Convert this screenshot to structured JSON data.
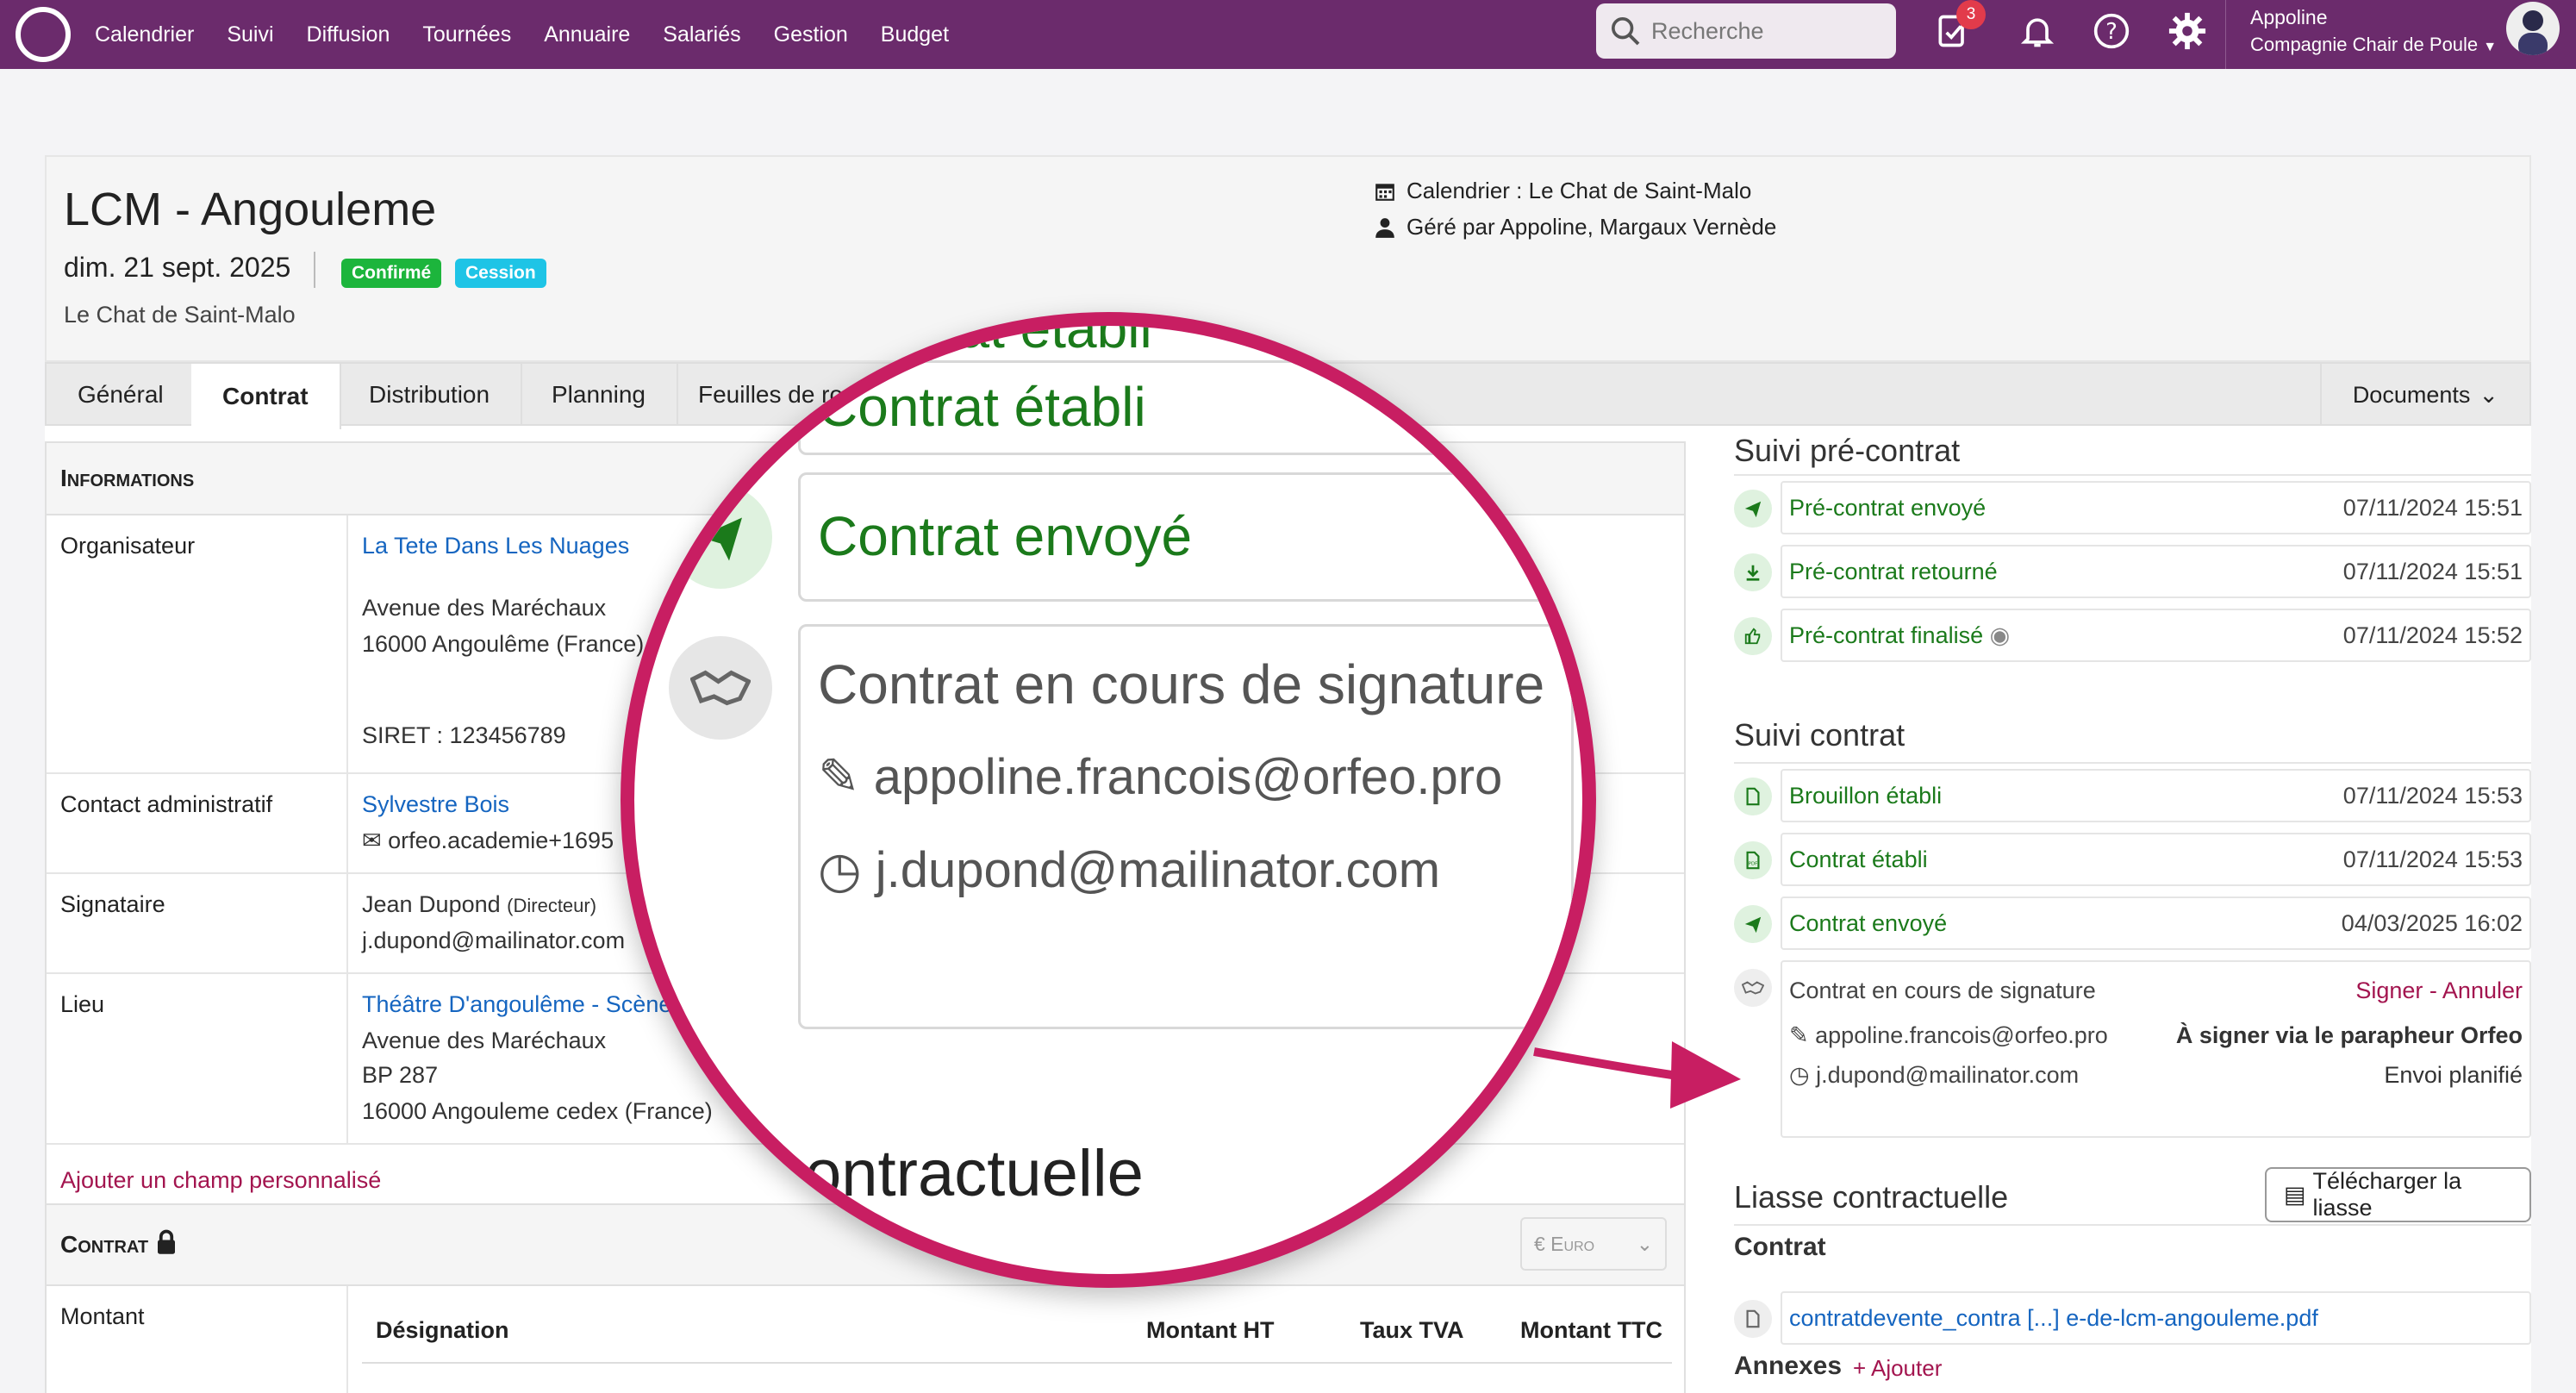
{
  "nav": {
    "items": [
      "Calendrier",
      "Suivi",
      "Diffusion",
      "Tournées",
      "Annuaire",
      "Salariés",
      "Gestion",
      "Budget"
    ],
    "search_placeholder": "Recherche",
    "notif_count": "3",
    "user_name": "Appoline",
    "user_company": "Compagnie Chair de Poule"
  },
  "header": {
    "title": "LCM - Angouleme",
    "date": "dim. 21 sept. 2025",
    "tag_confirmed": "Confirmé",
    "tag_cession": "Cession",
    "org": "Le Chat de Saint-Malo",
    "calendar": "Calendrier : Le Chat de Saint-Malo",
    "managed": "Géré par Appoline, Margaux Vernède"
  },
  "tabs": {
    "items": [
      "Général",
      "Contrat",
      "Distribution",
      "Planning",
      "Feuilles de route"
    ],
    "documents": "Documents"
  },
  "info": {
    "heading": "Informations",
    "organiser_label": "Organisateur",
    "organiser_name": "La Tete Dans Les Nuages",
    "organiser_addr1": "Avenue des Maréchaux",
    "organiser_addr2": "16000 Angoulême (France)",
    "organiser_siret": "SIRET : 123456789",
    "contact_label": "Contact administratif",
    "contact_name": "Sylvestre Bois",
    "contact_email": "orfeo.academie+1695",
    "signer_label": "Signataire",
    "signer_name": "Jean Dupond",
    "signer_role": "(Directeur)",
    "signer_email": "j.dupond@mailinator.com",
    "place_label": "Lieu",
    "place_name": "Théâtre D'angoulême - Scène",
    "place_addr1": "Avenue des Maréchaux",
    "place_addr2": "BP 287",
    "place_addr3": "16000 Angouleme cedex (France)",
    "add_field": "Ajouter un champ personnalisé"
  },
  "contract": {
    "heading": "Contrat",
    "currency": "€ Euro",
    "amount_label": "Montant",
    "col_designation": "Désignation",
    "col_ht": "Montant HT",
    "col_tva": "Taux TVA",
    "col_ttc": "Montant TTC"
  },
  "precontract": {
    "heading": "Suivi pré-contrat",
    "events": [
      {
        "label": "Pré-contrat envoyé",
        "date": "07/11/2024 15:51"
      },
      {
        "label": "Pré-contrat retourné",
        "date": "07/11/2024 15:51"
      },
      {
        "label": "Pré-contrat finalisé",
        "date": "07/11/2024 15:52"
      }
    ]
  },
  "contract_follow": {
    "heading": "Suivi contrat",
    "events": [
      {
        "label": "Brouillon établi",
        "date": "07/11/2024 15:53"
      },
      {
        "label": "Contrat établi",
        "date": "07/11/2024 15:53"
      },
      {
        "label": "Contrat envoyé",
        "date": "04/03/2025 16:02"
      }
    ],
    "signing": {
      "label": "Contrat en cours de signature",
      "actions": "Signer - Annuler",
      "email1": "appoline.francois@orfeo.pro",
      "note1": "À signer via le parapheur Orfeo",
      "email2": "j.dupond@mailinator.com",
      "note2": "Envoi planifié"
    }
  },
  "liasse": {
    "heading": "Liasse contractuelle",
    "download": "Télécharger la liasse",
    "contract_label": "Contrat",
    "file": "contratdevente_contra [...] e-de-lcm-angouleme.pdf",
    "annexes_label": "Annexes",
    "add": "+ Ajouter"
  },
  "magnifier": {
    "top_partial": "Contrat établi",
    "established": "Contrat établi",
    "sent": "Contrat envoyé",
    "signing": "Contrat en cours de signature",
    "email1": "appoline.francois@orfeo.pro",
    "email2": "j.dupond@mailinator.com",
    "bottom_partial": "contractuelle"
  },
  "colors": {
    "nav": "#6b2b6c",
    "accent": "#c81e62",
    "green": "#1b7a1b",
    "link": "#1565c0"
  }
}
